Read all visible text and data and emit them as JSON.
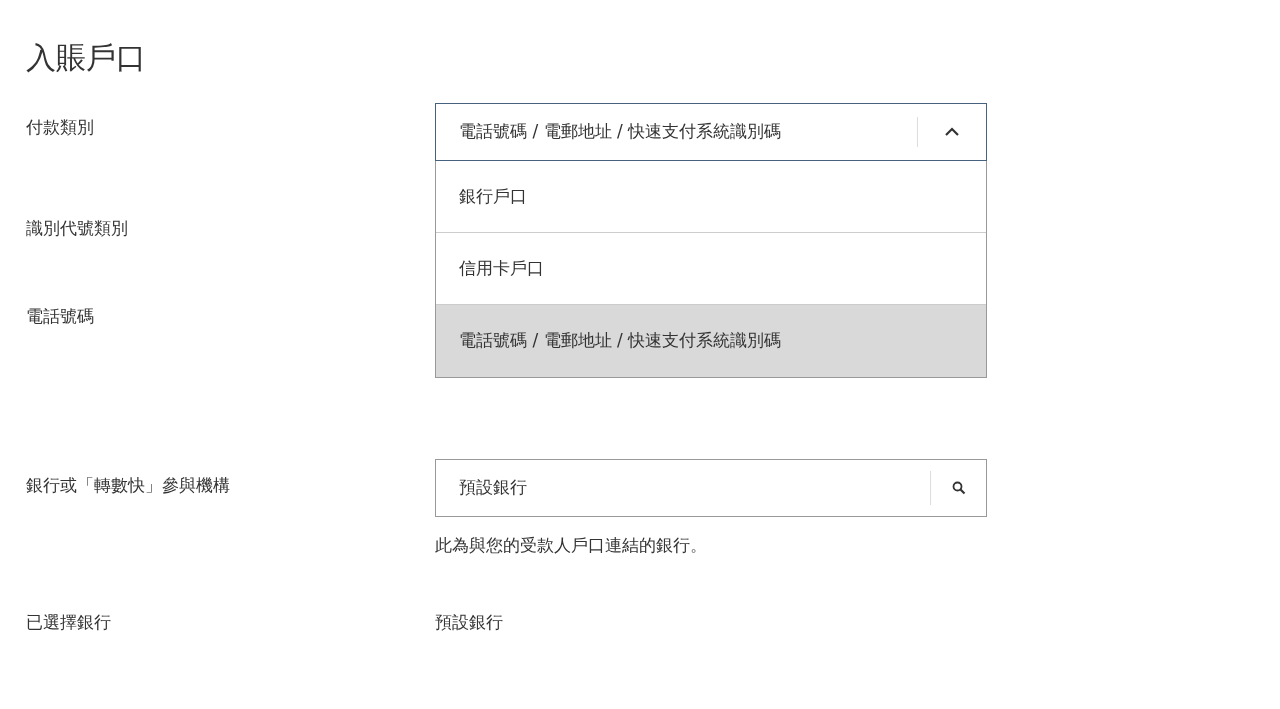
{
  "title": "入賬戶口",
  "payment_type": {
    "label": "付款類別",
    "value": "電話號碼 / 電郵地址 / 快速支付系統識別碼",
    "expanded": true,
    "options": [
      {
        "label": "銀行戶口",
        "selected": false
      },
      {
        "label": "信用卡戶口",
        "selected": false
      },
      {
        "label": "電話號碼 / 電郵地址 / 快速支付系統識別碼",
        "selected": true
      }
    ]
  },
  "id_type": {
    "label": "識別代號類別"
  },
  "phone": {
    "label": "電話號碼"
  },
  "bank": {
    "label": "銀行或「轉數快」參與機構",
    "value": "預設銀行",
    "help": "此為與您的受款人戶口連結的銀行。"
  },
  "selected_bank": {
    "label": "已選擇銀行",
    "value": "預設銀行"
  }
}
